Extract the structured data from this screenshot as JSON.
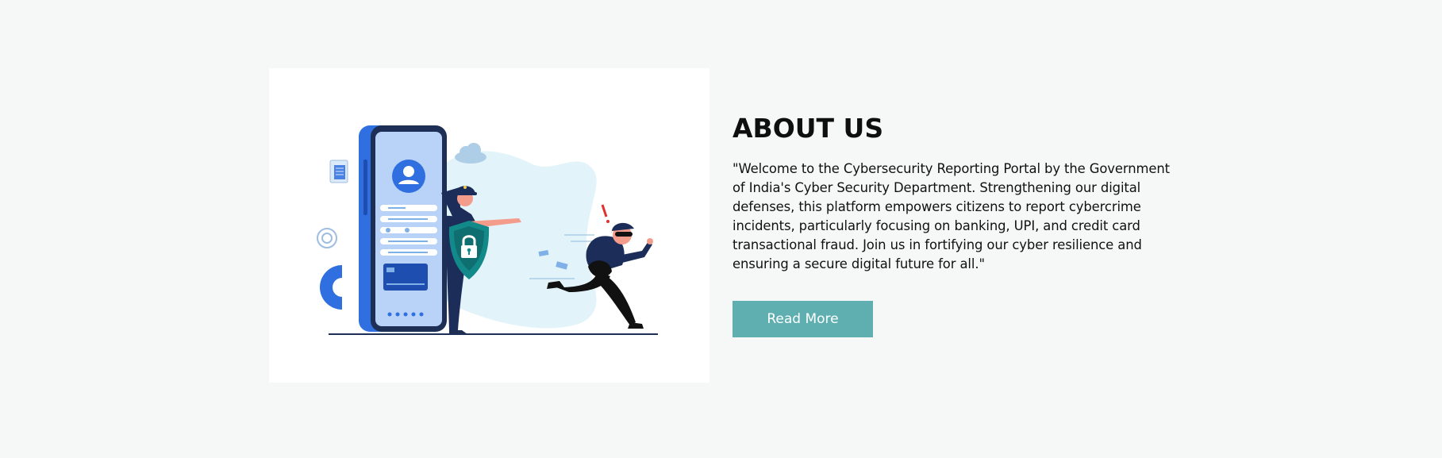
{
  "about": {
    "title": "ABOUT US",
    "description": "\"Welcome to the Cybersecurity Reporting Portal by the Government of India's Cyber Security Department. Strengthening our digital defenses, this platform empowers citizens to report cybercrime incidents, particularly focusing on banking, UPI, and credit card transactional fraud. Join us in fortifying our cyber resilience and ensuring a secure digital future for all.\"",
    "read_more_label": "Read More"
  },
  "colors": {
    "page_background": "#f6f8f8",
    "button_background": "#5fafb0",
    "button_text": "#ffffff",
    "title_text": "#0f0f0f",
    "phone_blue": "#2f6fe0",
    "police_navy": "#1c2d5a",
    "shield_teal": "#138a8a"
  },
  "illustration": {
    "icons": [
      "phone-icon",
      "user-avatar-icon",
      "credit-card-icon",
      "document-icon",
      "settings-gear-icon",
      "gear-icon",
      "cloud-icon",
      "police-officer-figure",
      "shield-lock-icon",
      "thief-figure",
      "exclamation-icon"
    ]
  }
}
